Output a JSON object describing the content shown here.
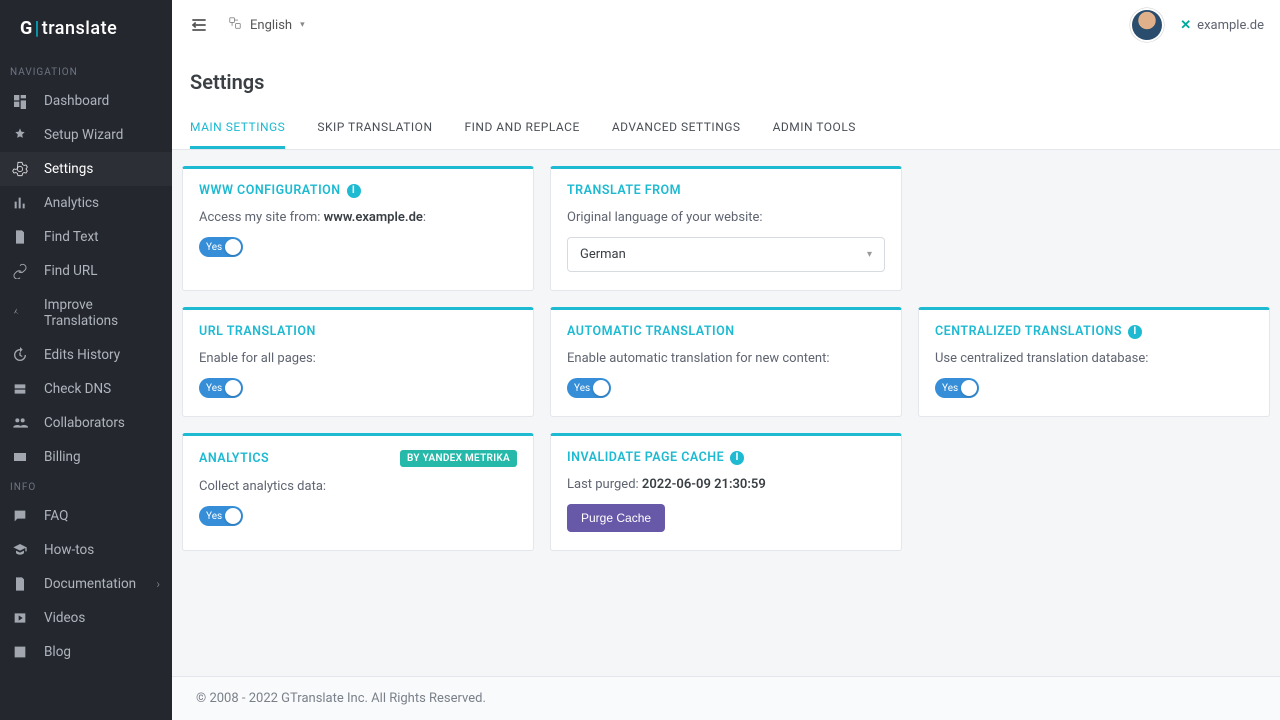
{
  "brand": {
    "g": "G",
    "sep": "|",
    "word": "translate"
  },
  "sidebar": {
    "heading_nav": "NAVIGATION",
    "heading_info": "INFO",
    "items_nav": [
      {
        "label": "Dashboard"
      },
      {
        "label": "Setup Wizard"
      },
      {
        "label": "Settings"
      },
      {
        "label": "Analytics"
      },
      {
        "label": "Find Text"
      },
      {
        "label": "Find URL"
      },
      {
        "label": "Improve Translations"
      },
      {
        "label": "Edits History"
      },
      {
        "label": "Check DNS"
      },
      {
        "label": "Collaborators"
      },
      {
        "label": "Billing"
      }
    ],
    "items_info": [
      {
        "label": "FAQ"
      },
      {
        "label": "How-tos"
      },
      {
        "label": "Documentation"
      },
      {
        "label": "Videos"
      },
      {
        "label": "Blog"
      }
    ]
  },
  "topbar": {
    "language": "English",
    "domain": "example.de"
  },
  "page": {
    "title": "Settings"
  },
  "tabs": [
    {
      "label": "Main Settings"
    },
    {
      "label": "Skip Translation"
    },
    {
      "label": "Find and Replace"
    },
    {
      "label": "Advanced Settings"
    },
    {
      "label": "Admin Tools"
    }
  ],
  "cards": {
    "www": {
      "title": "WWW Configuration",
      "text_prefix": "Access my site from: ",
      "text_strong": "www.example.de",
      "text_suffix": ":",
      "toggle": "Yes"
    },
    "translate_from": {
      "title": "Translate From",
      "text": "Original language of your website:",
      "select_value": "German"
    },
    "url_translation": {
      "title": "URL Translation",
      "text": "Enable for all pages:",
      "toggle": "Yes"
    },
    "auto_translation": {
      "title": "Automatic Translation",
      "text": "Enable automatic translation for new content:",
      "toggle": "Yes"
    },
    "centralized": {
      "title": "Centralized Translations",
      "text": "Use centralized translation database:",
      "toggle": "Yes"
    },
    "analytics": {
      "title": "Analytics",
      "badge": "BY YANDEX METRIKA",
      "text": "Collect analytics data:",
      "toggle": "Yes"
    },
    "cache": {
      "title": "Invalidate Page Cache",
      "text_prefix": "Last purged: ",
      "text_strong": "2022-06-09 21:30:59",
      "button": "Purge Cache"
    }
  },
  "footer": "© 2008 - 2022 GTranslate Inc. All Rights Reserved."
}
